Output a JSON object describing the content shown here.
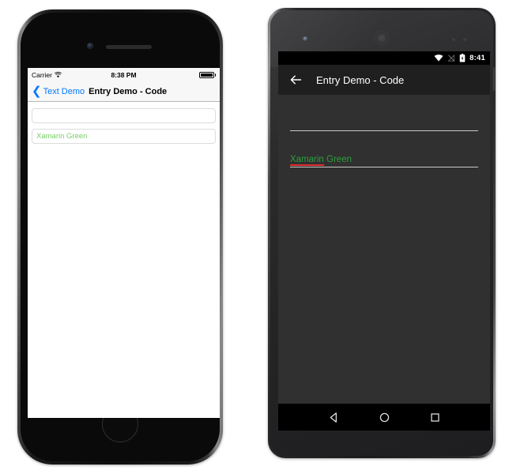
{
  "ios": {
    "status": {
      "carrier": "Carrier",
      "wifi_icon": "wifi-icon",
      "time": "8:38 PM",
      "battery_icon": "battery-full-icon"
    },
    "nav": {
      "back_icon": "chevron-left-icon",
      "back_label": "Text Demo",
      "title": "Entry Demo - Code"
    },
    "entries": [
      {
        "value": "",
        "placeholder": "",
        "name": "entry-empty"
      },
      {
        "value": "Xamarin Green",
        "placeholder": "",
        "name": "entry-xamarin-green"
      }
    ],
    "colors": {
      "accent": "#007aff",
      "entry_text_green": "#77d065",
      "nav_background": "#f7f7f7",
      "screen_background": "#ffffff"
    }
  },
  "android": {
    "status": {
      "wifi_icon": "wifi-icon",
      "signal_icon": "signal-no-sim-icon",
      "battery_icon": "battery-charging-icon",
      "time": "8:41"
    },
    "toolbar": {
      "back_icon": "arrow-left-icon",
      "title": "Entry Demo - Code"
    },
    "entries": [
      {
        "value": "",
        "placeholder": "",
        "name": "entry-empty"
      },
      {
        "value_misspelled": "Xamarin",
        "value_rest": " Green",
        "name": "entry-xamarin-green"
      }
    ],
    "navbar": {
      "back_icon": "triangle-back-icon",
      "home_icon": "circle-home-icon",
      "recents_icon": "square-recents-icon"
    },
    "colors": {
      "toolbar_background": "#1f1f1f",
      "screen_background": "#303030",
      "entry_text_green": "#2e9e3e",
      "spellcheck_underline": "#e03030",
      "statusbar_background": "#000000"
    }
  }
}
